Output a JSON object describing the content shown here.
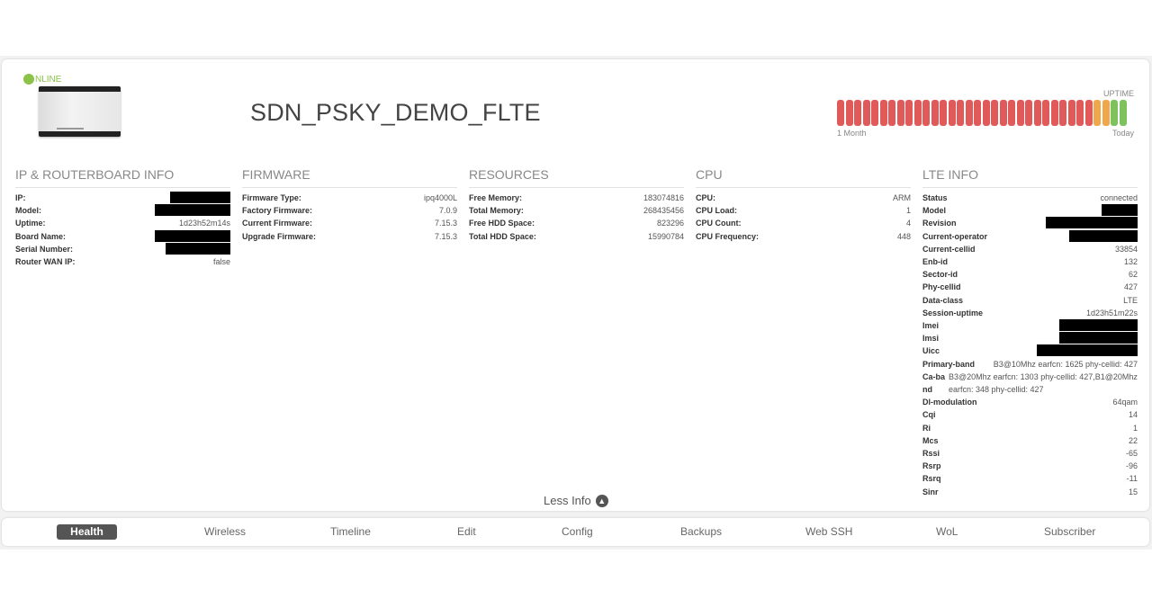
{
  "device": {
    "status": "NLINE",
    "title": "SDN_PSKY_DEMO_FLTE"
  },
  "uptime": {
    "label": "UPTIME",
    "start_label": "1 Month",
    "end_label": "Today",
    "segments": [
      "red",
      "red",
      "red",
      "red",
      "red",
      "red",
      "red",
      "red",
      "red",
      "red",
      "red",
      "red",
      "red",
      "red",
      "red",
      "red",
      "red",
      "red",
      "red",
      "red",
      "red",
      "red",
      "red",
      "red",
      "red",
      "red",
      "red",
      "red",
      "red",
      "red",
      "orange",
      "orange",
      "green",
      "green"
    ],
    "colors": {
      "red": "#e05a5a",
      "orange": "#f0a64a",
      "green": "#7ec25e"
    }
  },
  "sections": {
    "ip_info": {
      "title": "IP & ROUTERBOARD INFO",
      "rows": [
        {
          "k": "IP:",
          "v": ""
        },
        {
          "k": "Model:",
          "v": ""
        },
        {
          "k": "Uptime:",
          "v": "1d23h52m14s"
        },
        {
          "k": "Board Name:",
          "v": ""
        },
        {
          "k": "Serial Number:",
          "v": ""
        },
        {
          "k": "Router WAN IP:",
          "v": "false"
        }
      ]
    },
    "firmware": {
      "title": "FIRMWARE",
      "rows": [
        {
          "k": "Firmware Type:",
          "v": "ipq4000L"
        },
        {
          "k": "Factory Firmware:",
          "v": "7.0.9"
        },
        {
          "k": "Current Firmware:",
          "v": "7.15.3"
        },
        {
          "k": "Upgrade Firmware:",
          "v": "7.15.3"
        }
      ]
    },
    "resources": {
      "title": "RESOURCES",
      "rows": [
        {
          "k": "Free Memory:",
          "v": "183074816"
        },
        {
          "k": "Total Memory:",
          "v": "268435456"
        },
        {
          "k": "Free HDD Space:",
          "v": "823296"
        },
        {
          "k": "Total HDD Space:",
          "v": "15990784"
        }
      ]
    },
    "cpu": {
      "title": "CPU",
      "rows": [
        {
          "k": "CPU:",
          "v": "ARM"
        },
        {
          "k": "CPU Load:",
          "v": "1"
        },
        {
          "k": "CPU Count:",
          "v": "4"
        },
        {
          "k": "CPU Frequency:",
          "v": "448"
        }
      ]
    },
    "lte": {
      "title": "LTE INFO",
      "rows": [
        {
          "k": "Status",
          "v": "connected"
        },
        {
          "k": "Model",
          "v": ""
        },
        {
          "k": "Revision",
          "v": ""
        },
        {
          "k": "Current-operator",
          "v": ""
        },
        {
          "k": "Current-cellid",
          "v": "33854"
        },
        {
          "k": "Enb-id",
          "v": "132"
        },
        {
          "k": "Sector-id",
          "v": "62"
        },
        {
          "k": "Phy-cellid",
          "v": "427"
        },
        {
          "k": "Data-class",
          "v": "LTE"
        },
        {
          "k": "Session-uptime",
          "v": "1d23h51m22s"
        },
        {
          "k": "Imei",
          "v": ""
        },
        {
          "k": "Imsi",
          "v": ""
        },
        {
          "k": "Uicc",
          "v": ""
        },
        {
          "k": "Primary-band",
          "v": "B3@10Mhz earfcn: 1625 phy-cellid: 427"
        },
        {
          "k": "Ca-band",
          "v": "B3@20Mhz earfcn: 1303 phy-cellid: 427,B1@20Mhz earfcn: 348 phy-cellid: 427"
        },
        {
          "k": "Dl-modulation",
          "v": "64qam"
        },
        {
          "k": "Cqi",
          "v": "14"
        },
        {
          "k": "Ri",
          "v": "1"
        },
        {
          "k": "Mcs",
          "v": "22"
        },
        {
          "k": "Rssi",
          "v": "-65"
        },
        {
          "k": "Rsrp",
          "v": "-96"
        },
        {
          "k": "Rsrq",
          "v": "-11"
        },
        {
          "k": "Sinr",
          "v": "15"
        }
      ]
    }
  },
  "less_info": "Less Info",
  "tabs": [
    "Health",
    "Wireless",
    "Timeline",
    "Edit",
    "Config",
    "Backups",
    "Web SSH",
    "WoL",
    "Subscriber"
  ]
}
